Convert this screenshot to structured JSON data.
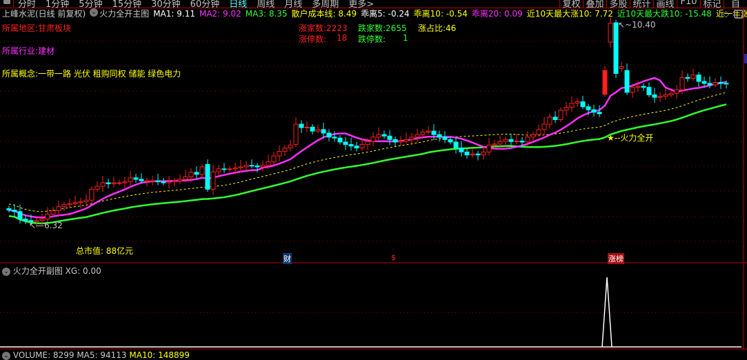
{
  "toolbar": {
    "periods": [
      "分时",
      "1分钟",
      "5分钟",
      "15分钟",
      "30分钟",
      "60分钟",
      "日线",
      "周线",
      "月线",
      "多周期",
      "更多>"
    ],
    "active": "日线",
    "tools": [
      "复权",
      "叠加",
      "多股",
      "统计",
      "画线",
      "F10",
      "标记",
      "自"
    ]
  },
  "info": {
    "stock": "上峰水泥(日线 前复权)",
    "indicator": "火力全开主图",
    "ma1": "MA1: 9.11",
    "ma2": "MA2: 9.02",
    "ma3": "MA3: 8.35",
    "cost": "散户成本线: 8.49",
    "bias5": "乖离5: -0.24",
    "bias10": "乖离10: -0.54",
    "bias20": "乖离20: 0.09",
    "max_up": "近10天最大涨10: 7.72",
    "max_down": "近10天最大跌10: -15.48",
    "limit_up_year": "近一年涨停数:"
  },
  "overlay": {
    "region": "所属地区:甘肃板块",
    "industry": "所属行业:建材",
    "concept": "所属概念:一带一路 光伏 租购同权 储能 绿色电力",
    "up_count": "涨家数:2223",
    "down_count": "跌家数:2655",
    "up_ratio": "涨占比:46",
    "limit_up": "涨停数:",
    "limit_up_val": "18",
    "limit_down": "跌停数:",
    "limit_down_val": "1",
    "market_cap": "总市值: 88亿元",
    "high_label": "10.40",
    "low_label": "6.32",
    "signal": "★--火力全开",
    "markers": {
      "cai": "财",
      "dollar": "$",
      "zhangbang": "涨榜"
    }
  },
  "sub": {
    "title": "火力全开副图",
    "xg": "XG: 0.00"
  },
  "volume": {
    "label": "VOLUME: 8299",
    "ma5": "MA5: 94113",
    "ma10": "MA10: 148899"
  },
  "colors": {
    "up": "#ff2020",
    "down": "#00ffff",
    "ma_short": "#ff30ff",
    "ma_long": "#30ff30",
    "cost": "#ffff00",
    "grid": "#a00000"
  },
  "chart_data": {
    "type": "candlestick",
    "price_range": [
      6.32,
      10.4
    ],
    "closes": [
      6.63,
      6.6,
      6.45,
      6.42,
      6.4,
      6.42,
      6.45,
      6.55,
      6.62,
      6.7,
      6.74,
      6.76,
      6.78,
      6.8,
      6.83,
      7.05,
      7.11,
      7.18,
      7.16,
      7.18,
      7.18,
      7.2,
      7.28,
      7.25,
      7.22,
      7.22,
      7.22,
      7.2,
      7.18,
      7.2,
      7.22,
      7.25,
      7.3,
      7.39,
      7.35,
      7.5,
      7.05,
      7.4,
      7.46,
      7.45,
      7.46,
      7.48,
      7.5,
      7.53,
      7.52,
      7.5,
      7.53,
      7.6,
      7.72,
      7.81,
      7.88,
      7.94,
      8.36,
      8.29,
      8.3,
      8.22,
      8.25,
      8.18,
      8.1,
      8.08,
      8.0,
      7.95,
      7.92,
      7.88,
      7.95,
      8.01,
      8.1,
      8.15,
      8.12,
      8.05,
      8.0,
      8.02,
      8.05,
      8.1,
      8.15,
      8.2,
      8.22,
      8.15,
      8.1,
      8.05,
      8.0,
      7.88,
      7.8,
      7.74,
      7.76,
      7.74,
      7.8,
      7.94,
      7.96,
      8.01,
      8.05,
      8.01,
      8.02,
      8.0,
      8.1,
      8.15,
      8.25,
      8.36,
      8.5,
      8.45,
      8.64,
      8.7,
      8.78,
      8.81,
      8.71,
      8.65,
      8.6,
      8.57,
      9.44,
      10.39,
      9.38,
      9.52,
      9.0,
      9.1,
      9.12,
      9.1,
      8.95,
      8.9,
      8.92,
      8.95,
      8.98,
      9.05,
      9.3,
      9.28,
      9.35,
      9.22,
      9.18,
      9.15,
      9.2,
      9.18,
      9.17
    ],
    "open_overrides": {
      "36": 7.55,
      "52": 7.95,
      "108": 8.96,
      "109": 10.01,
      "110": 10.4,
      "111": 9.48,
      "112": 9.44,
      "122": 9.05
    },
    "signal_index": 109
  }
}
